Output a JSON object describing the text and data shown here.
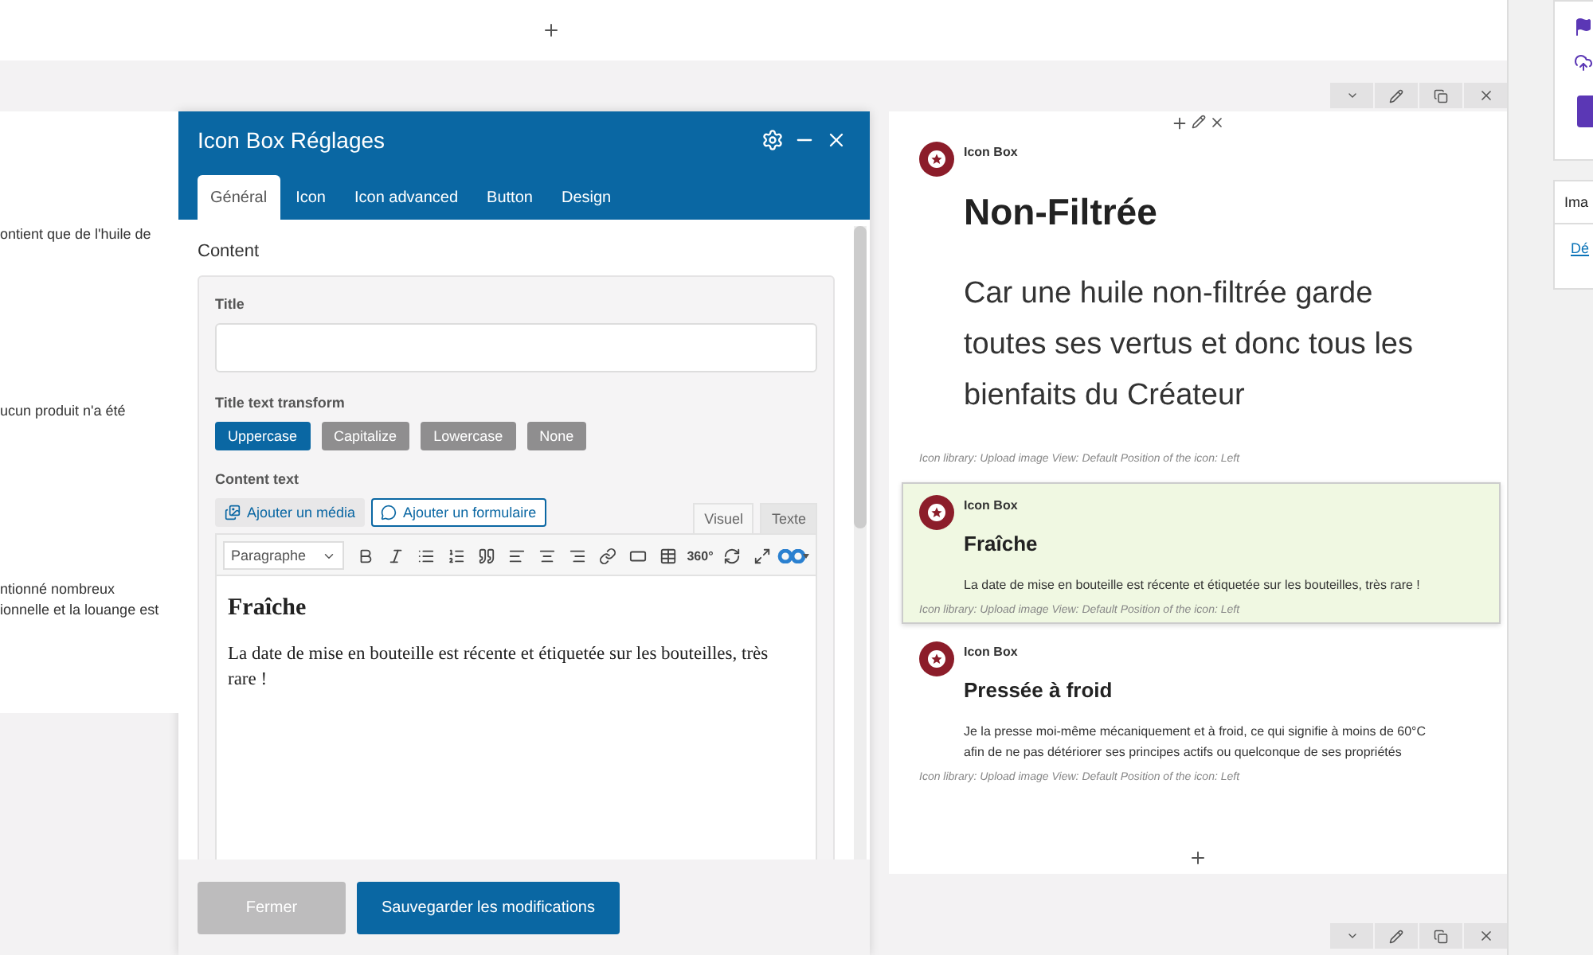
{
  "background_texts": [
    "ontient que de l'huile de",
    "ucun produit n'a été",
    "ntionné nombreux",
    "ionnelle et la louange est"
  ],
  "dialog": {
    "title": "Icon Box Réglages",
    "tabs": [
      {
        "label": "Général",
        "selected": true
      },
      {
        "label": "Icon",
        "selected": false
      },
      {
        "label": "Icon advanced",
        "selected": false
      },
      {
        "label": "Button",
        "selected": false
      },
      {
        "label": "Design",
        "selected": false
      }
    ],
    "section": "Content",
    "title_field": {
      "label": "Title"
    },
    "transform": {
      "label": "Title text transform",
      "options": [
        {
          "label": "Uppercase",
          "selected": true
        },
        {
          "label": "Capitalize",
          "selected": false
        },
        {
          "label": "Lowercase",
          "selected": false
        },
        {
          "label": "None",
          "selected": false
        }
      ]
    },
    "content_text": {
      "label": "Content text",
      "media_buttons": [
        {
          "label": "Ajouter un média",
          "kind": "media"
        },
        {
          "label": "Ajouter un formulaire",
          "kind": "form"
        }
      ],
      "editor_tabs": [
        {
          "label": "Visuel",
          "selected": true
        },
        {
          "label": "Texte",
          "selected": false
        }
      ],
      "format": "Paragraphe",
      "badge_360": "360°",
      "heading": "Fraîche",
      "body": "La date de mise en bouteille est récente et étiquetée sur les bouteilles, très rare !"
    },
    "buttons": [
      {
        "label": "Fermer",
        "kind": "secondary"
      },
      {
        "label": "Sauvegarder les modifications",
        "kind": "primary"
      }
    ]
  },
  "preview": {
    "blocks": [
      {
        "kind": "large",
        "selected": false,
        "type_label": "Icon Box",
        "title": "Non-Filtrée",
        "text": "Car une huile non-filtrée garde toutes ses vertus et donc tous les bienfaits du Créateur",
        "meta": "Icon library: Upload image  View: Default  Position of the icon: Left"
      },
      {
        "kind": "small",
        "selected": true,
        "type_label": "Icon Box",
        "title": "Fraîche",
        "text": "La date de mise en bouteille est récente et étiquetée sur les bouteilles, très rare !",
        "meta": "Icon library: Upload image  View: Default  Position of the icon: Left"
      },
      {
        "kind": "small",
        "selected": false,
        "type_label": "Icon Box",
        "title": "Pressée à froid",
        "text": "Je la presse moi-même mécaniquement et à froid, ce qui signifie à moins de 60°C afin de ne pas détériorer ses principes actifs ou quelconque de ses propriétés",
        "meta": "Icon library: Upload image  View: Default  Position of the icon: Left"
      }
    ]
  },
  "sidebar": {
    "card_heading": "Ima",
    "card_link": "Dé"
  }
}
